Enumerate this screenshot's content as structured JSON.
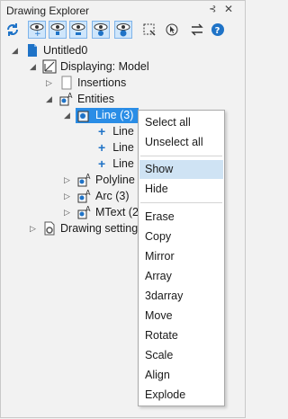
{
  "panel": {
    "title": "Drawing Explorer"
  },
  "tree": {
    "drawing": "Untitled0",
    "displaying": "Displaying: Model",
    "insertions": "Insertions",
    "entities": "Entities",
    "line_group": "Line (3)",
    "line_item": "Line",
    "polyline": "Polyline",
    "arc": "Arc (3)",
    "mtext": "MText (2",
    "drawing_settings": "Drawing setting"
  },
  "context_menu": {
    "select_all": "Select all",
    "unselect_all": "Unselect all",
    "show": "Show",
    "hide": "Hide",
    "erase": "Erase",
    "copy": "Copy",
    "mirror": "Mirror",
    "array": "Array",
    "darray": "3darray",
    "move": "Move",
    "rotate": "Rotate",
    "scale": "Scale",
    "align": "Align",
    "explode": "Explode"
  },
  "colors": {
    "accent": "#2a8de6",
    "hover": "#cfe3f4",
    "icon_blue": "#1f73c7"
  }
}
